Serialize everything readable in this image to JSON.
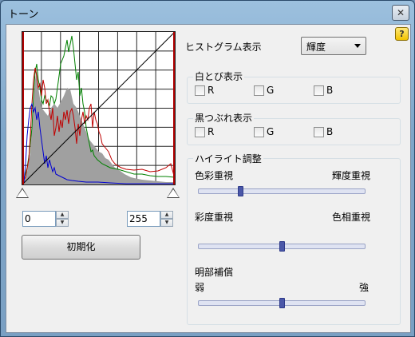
{
  "window": {
    "title": "トーン",
    "close_glyph": "✕",
    "help_glyph": "?"
  },
  "histogram": {
    "min_value": "0",
    "max_value": "255",
    "reset_label": "初期化",
    "colors": {
      "red": "#c00000",
      "green": "#008000",
      "blue": "#0000d0",
      "luma": "#a0a0a0"
    }
  },
  "histogram_display": {
    "label": "ヒストグラム表示",
    "selected": "輝度"
  },
  "highlight_clip": {
    "title": "白とび表示",
    "channels": [
      {
        "label": "R"
      },
      {
        "label": "G"
      },
      {
        "label": "B"
      }
    ]
  },
  "shadow_clip": {
    "title": "黒つぶれ表示",
    "channels": [
      {
        "label": "R"
      },
      {
        "label": "G"
      },
      {
        "label": "B"
      }
    ]
  },
  "highlight_adjust": {
    "title": "ハイライト調整",
    "sliders": [
      {
        "left_label": "色彩重視",
        "right_label": "輝度重視",
        "value": 0.25
      },
      {
        "left_label": "彩度重視",
        "right_label": "色相重視",
        "value": 0.5
      },
      {
        "left_label": "弱",
        "right_label": "強",
        "value": 0.5
      }
    ],
    "brightness_label": "明部補償"
  }
}
